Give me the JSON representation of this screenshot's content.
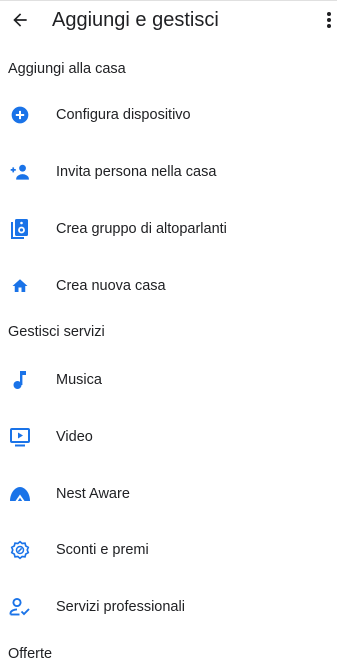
{
  "app_bar": {
    "title": "Aggiungi e gestisci",
    "back_icon": "arrow-back-icon",
    "menu_icon": "more-vert-icon"
  },
  "colors": {
    "accent": "#1a73e8",
    "text": "#202124"
  },
  "sections": [
    {
      "header": "Aggiungi alla casa",
      "items": [
        {
          "label": "Configura dispositivo",
          "icon": "add-circle-icon"
        },
        {
          "label": "Invita persona nella casa",
          "icon": "person-add-icon"
        },
        {
          "label": "Crea gruppo di altoparlanti",
          "icon": "speaker-group-icon"
        },
        {
          "label": "Crea nuova casa",
          "icon": "home-icon"
        }
      ]
    },
    {
      "header": "Gestisci servizi",
      "items": [
        {
          "label": "Musica",
          "icon": "music-note-icon"
        },
        {
          "label": "Video",
          "icon": "video-play-icon"
        },
        {
          "label": "Nest Aware",
          "icon": "nest-aware-icon"
        },
        {
          "label": "Sconti e premi",
          "icon": "offer-badge-icon"
        },
        {
          "label": "Servizi professionali",
          "icon": "person-check-icon"
        }
      ]
    },
    {
      "header": "Offerte",
      "items": []
    }
  ]
}
